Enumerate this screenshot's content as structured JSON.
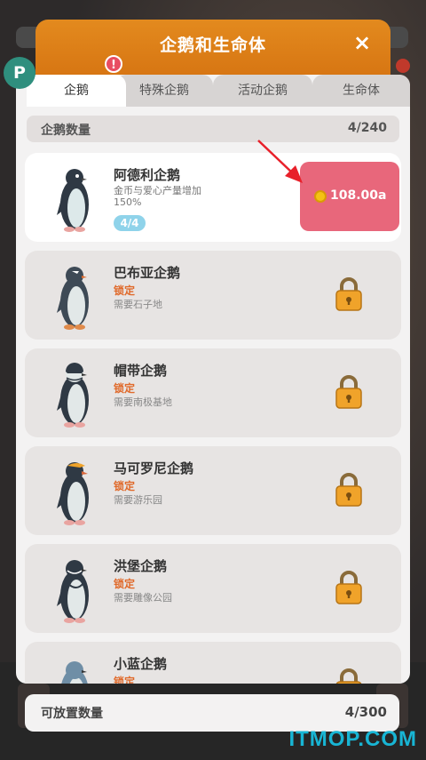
{
  "modal": {
    "title": "企鹅和生命体",
    "close_label": "×"
  },
  "badge": {
    "label": "P"
  },
  "tabs": [
    {
      "label": "企鹅",
      "active": true
    },
    {
      "label": "特殊企鹅",
      "active": false
    },
    {
      "label": "活动企鹅",
      "active": false
    },
    {
      "label": "生命体",
      "active": false
    }
  ],
  "tab_alert": "!",
  "count_bar": {
    "label": "企鹅数量",
    "value": "4/240"
  },
  "penguins": [
    {
      "name": "阿德利企鹅",
      "desc": "金币与爱心产量增加150%",
      "level": "4/4",
      "price": "108.00a"
    },
    {
      "name": "巴布亚企鹅",
      "status": "锁定",
      "requirement": "需要石子地"
    },
    {
      "name": "帽带企鹅",
      "status": "锁定",
      "requirement": "需要南极基地"
    },
    {
      "name": "马可罗尼企鹅",
      "status": "锁定",
      "requirement": "需要游乐园"
    },
    {
      "name": "洪堡企鹅",
      "status": "锁定",
      "requirement": "需要雕像公园"
    },
    {
      "name": "小蓝企鹅",
      "status": "锁定",
      "requirement": ""
    }
  ],
  "footer": {
    "label": "可放置数量",
    "value": "4/300"
  },
  "watermark": "ITMOP.COM",
  "colors": {
    "header": "#e38a1e",
    "buy_button": "#e8677b",
    "tab_active": "#ffffff",
    "lock": "#f0a32a"
  }
}
